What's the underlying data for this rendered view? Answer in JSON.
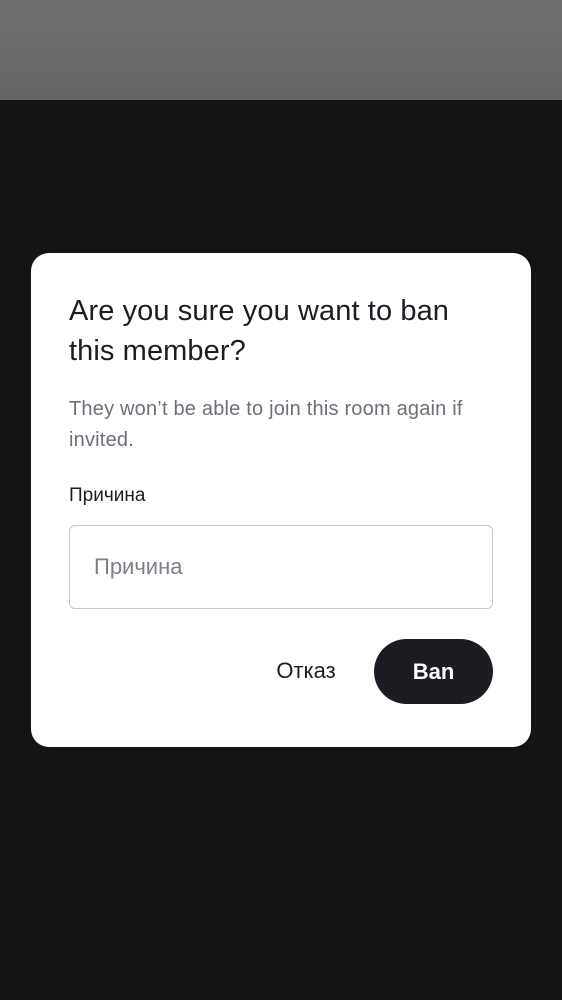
{
  "dialog": {
    "title": "Are you sure you want to ban this member?",
    "body": "They won’t be able to join this room again if invited.",
    "field_label": "Причина",
    "input": {
      "value": "",
      "placeholder": "Причина"
    },
    "cancel_label": "Отказ",
    "confirm_label": "Ban"
  },
  "colors": {
    "dialog_background": "#ffffff",
    "scrim": "#141414",
    "status_bar": "#6a6a6a",
    "primary_button": "#1b1d22",
    "secondary_text": "#6b6f78"
  }
}
